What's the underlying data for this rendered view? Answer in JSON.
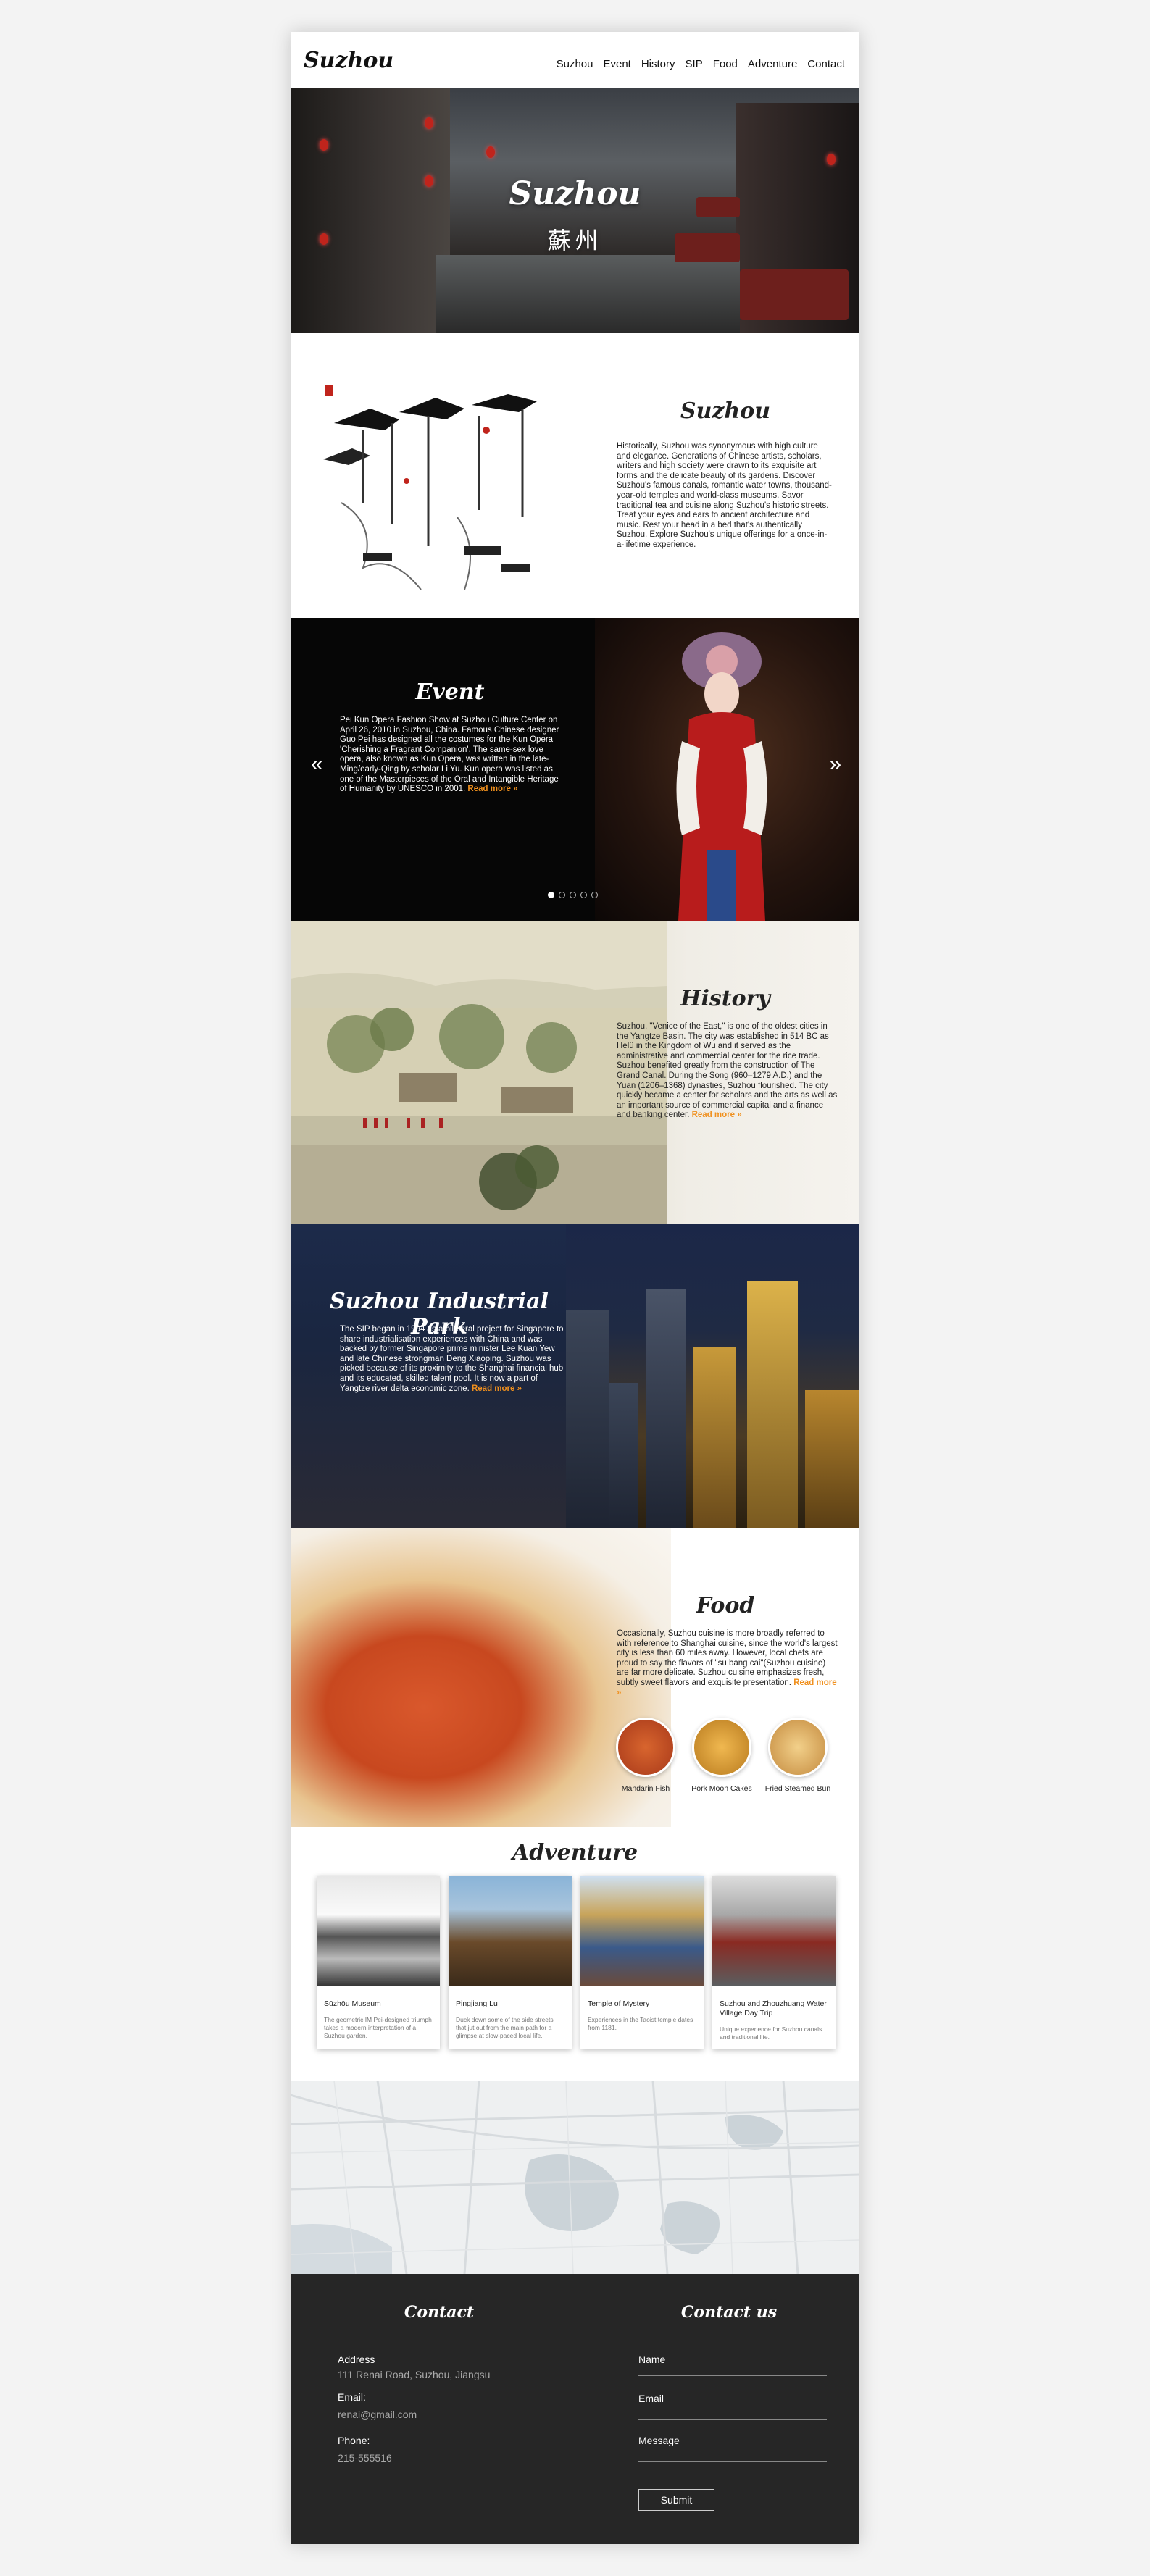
{
  "header": {
    "logo": "Suzhou",
    "nav": [
      "Suzhou",
      "Event",
      "History",
      "SIP",
      "Food",
      "Adventure",
      "Contact"
    ]
  },
  "hero": {
    "title": "Suzhou",
    "subtitle": "蘇州"
  },
  "intro": {
    "title": "Suzhou",
    "text": "Historically, Suzhou was synonymous with high culture and elegance. Generations of Chinese artists, scholars, writers and high society were drawn to its exquisite art forms and the delicate beauty of its gardens. Discover Suzhou's famous canals, romantic water towns, thousand-year-old temples and world-class museums. Savor traditional tea and cuisine along Suzhou's historic streets. Treat your eyes and ears to ancient architecture and music. Rest your head in a bed that's authentically Suzhou. Explore Suzhou's unique offerings for a once-in-a-lifetime experience."
  },
  "event": {
    "title": "Event",
    "text": "Pei Kun Opera Fashion Show at Suzhou Culture Center on April 26, 2010 in Suzhou, China. Famous Chinese designer Guo Pei has designed all the costumes for the Kun Opera 'Cherishing a Fragrant Companion'. The same-sex love opera, also known as Kun Opera, was written in the late-Ming/early-Qing by scholar Li Yu. Kun opera was listed as one of the Masterpieces of the Oral and Intangible Heritage of Humanity by UNESCO in 2001.",
    "read_more": "Read more »",
    "prev": "«",
    "next": "»",
    "dots": 5,
    "active_dot": 1
  },
  "history": {
    "title": "History",
    "text": "Suzhou, \"Venice of the East,\" is one of the oldest cities in the Yangtze Basin. The city was established in 514 BC as Helü in the Kingdom of Wu and it served as the administrative and commercial center for the rice trade. Suzhou benefited greatly from the construction of The Grand Canal. During the Song (960–1279 A.D.) and the Yuan (1206–1368) dynasties, Suzhou flourished. The city quickly became a center for scholars and the arts as well as an important source of commercial capital and a finance and banking center.",
    "read_more": "Read more »"
  },
  "sip": {
    "title": "Suzhou Industrial Park",
    "text": "The SIP began in 1994 as a bilateral project for Singapore to share industrialisation experiences with China and was backed by former Singapore prime minister Lee Kuan Yew and late Chinese strongman Deng Xiaoping. Suzhou was picked because of its proximity to the Shanghai financial hub and its educated, skilled talent pool. It is now a part of Yangtze river delta economic zone.",
    "read_more": "Read more »"
  },
  "food": {
    "title": "Food",
    "text": "Occasionally, Suzhou cuisine is more broadly referred to with reference to Shanghai cuisine, since the world's largest city is less than 60 miles away. However, local chefs are proud to say the flavors of \"su bang cai\"(Suzhou cuisine) are far more delicate. Suzhou cuisine emphasizes fresh, subtly sweet flavors and exquisite presentation.",
    "read_more": "Read more »",
    "dishes": [
      {
        "name": "Mandarin Fish",
        "color": "#c8552a"
      },
      {
        "name": "Pork Moon Cakes",
        "color": "#d9952e"
      },
      {
        "name": "Fried Steamed Bun",
        "color": "#e0b064"
      }
    ]
  },
  "adventure": {
    "title": "Adventure",
    "cards": [
      {
        "name": "Sūzhōu Museum",
        "desc": "The geometric IM Pei-designed triumph takes a modern interpretation of a Suzhou garden."
      },
      {
        "name": "Pingjiang Lu",
        "desc": "Duck down some of the side streets that jut out from the main path for a glimpse at slow-paced local life."
      },
      {
        "name": "Temple of Mystery",
        "desc": "Experiences in the Taoist temple dates from 1181."
      },
      {
        "name": "Suzhou and Zhouzhuang Water Village Day Trip",
        "desc": "Unique experience for Suzhou canals and traditional life."
      }
    ]
  },
  "contact": {
    "left_title": "Contact",
    "right_title": "Contact us",
    "address_label": "Address",
    "address": "111 Renai Road, Suzhou, Jiangsu",
    "email_label": "Email:",
    "email": "renai@gmail.com",
    "phone_label": "Phone:",
    "phone": "215-555516",
    "form_name": "Name",
    "form_email": "Email",
    "form_message": "Message",
    "submit": "Submit"
  },
  "colors": {
    "accent": "#f0901e",
    "footer": "#262626"
  }
}
